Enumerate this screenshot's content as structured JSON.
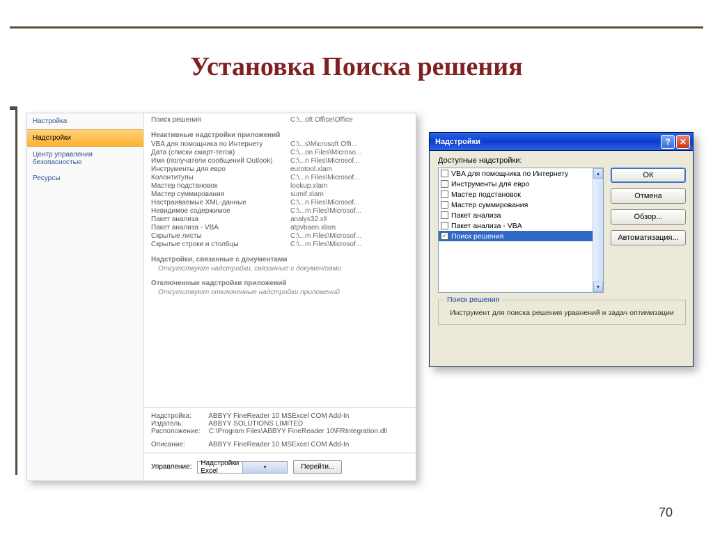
{
  "slide": {
    "title": "Установка Поиска решения",
    "page_number": "70"
  },
  "options": {
    "sidebar": [
      {
        "label": "Настройка",
        "selected": false
      },
      {
        "label": "Надстройки",
        "selected": true
      },
      {
        "label": "Центр управления безопасностью",
        "selected": false
      },
      {
        "label": "Ресурсы",
        "selected": false
      }
    ],
    "active_items": [
      {
        "name": "Поиск решения",
        "path": "C:\\...oft Office\\Office"
      }
    ],
    "inactive_header": "Неактивные надстройки приложений",
    "inactive_items": [
      {
        "name": "VBA для помощника по Интернету",
        "path": "C:\\...s\\Microsoft Offi..."
      },
      {
        "name": "Дата (списки смарт-тегов)",
        "path": "C:\\...on Files\\Microso..."
      },
      {
        "name": "Имя (получатели сообщений Outlook)",
        "path": "C:\\...n Files\\Microsof..."
      },
      {
        "name": "Инструменты для евро",
        "path": "eurotool.xlam"
      },
      {
        "name": "Колонтитулы",
        "path": "C:\\...n Files\\Microsof..."
      },
      {
        "name": "Мастер подстановок",
        "path": "lookup.xlam"
      },
      {
        "name": "Мастер суммирования",
        "path": "sumif.xlam"
      },
      {
        "name": "Настраиваемые XML-данные",
        "path": "C:\\...n Files\\Microsof..."
      },
      {
        "name": "Невидимое содержимое",
        "path": "C:\\...m Files\\Microsof..."
      },
      {
        "name": "Пакет анализа",
        "path": "analys32.xll"
      },
      {
        "name": "Пакет анализа - VBA",
        "path": "atpvbaen.xlam"
      },
      {
        "name": "Скрытые листы",
        "path": "C:\\...m Files\\Microsof..."
      },
      {
        "name": "Скрытые строки и столбцы",
        "path": "C:\\...m Files\\Microsof..."
      }
    ],
    "doc_header": "Надстройки, связанные с документами",
    "doc_none": "Отсутствуют надстройки, связанные с документами",
    "disabled_header": "Отключенные надстройки приложений",
    "disabled_none": "Отсутствуют отключенные надстройки приложений",
    "details": {
      "addin_label": "Надстройка:",
      "addin_value": "ABBYY FineReader 10 MSExcel COM Add-In",
      "publisher_label": "Издатель:",
      "publisher_value": "ABBYY SOLUTIONS LIMITED",
      "location_label": "Расположение:",
      "location_value": "C:\\Program Files\\ABBYY FineReader 10\\FRIntegration.dll",
      "desc_label": "Описание:",
      "desc_value": "ABBYY FineReader 10 MSExcel COM Add-In"
    },
    "manage_label": "Управление:",
    "manage_value": "Надстройки Excel",
    "go_button": "Перейти..."
  },
  "dialog": {
    "title": "Надстройки",
    "available_label": "Доступные надстройки:",
    "items": [
      {
        "label": "VBA для помощника по Интернету",
        "checked": false,
        "selected": false
      },
      {
        "label": "Инструменты для евро",
        "checked": false,
        "selected": false
      },
      {
        "label": "Мастер подстановок",
        "checked": false,
        "selected": false
      },
      {
        "label": "Мастер суммирования",
        "checked": false,
        "selected": false
      },
      {
        "label": "Пакет анализа",
        "checked": false,
        "selected": false
      },
      {
        "label": "Пакет анализа - VBA",
        "checked": false,
        "selected": false
      },
      {
        "label": "Поиск решения",
        "checked": true,
        "selected": true
      }
    ],
    "buttons": {
      "ok": "ОК",
      "cancel": "Отмена",
      "browse": "Обзор...",
      "automation": "Автоматизация..."
    },
    "group_legend": "Поиск решения",
    "group_desc": "Инструмент для поиска решения уравнений и задач оптимизации"
  }
}
